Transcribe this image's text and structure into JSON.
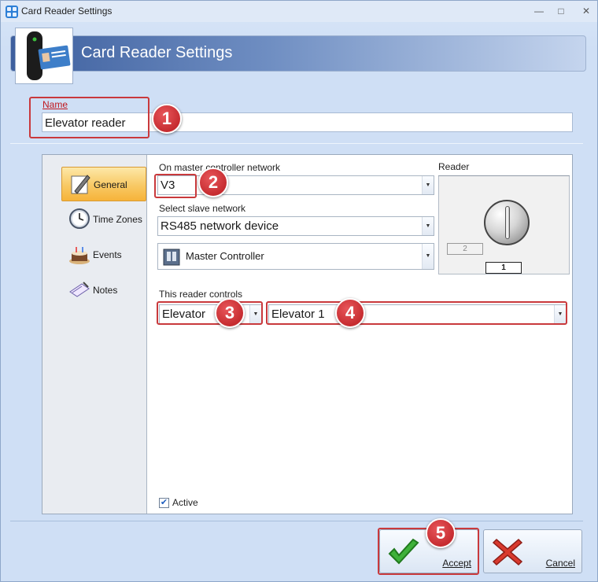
{
  "window": {
    "title": "Card Reader Settings",
    "min_glyph": "—",
    "max_glyph": "□",
    "close_glyph": "✕"
  },
  "header": {
    "title": "Card Reader Settings"
  },
  "name": {
    "label": "Name",
    "value": "Elevator reader"
  },
  "nav": {
    "items": [
      {
        "label": "General",
        "icon": "pencil-paper-icon",
        "active": true
      },
      {
        "label": "Time Zones",
        "icon": "clock-icon",
        "active": false
      },
      {
        "label": "Events",
        "icon": "cake-icon",
        "active": false
      },
      {
        "label": "Notes",
        "icon": "notes-icon",
        "active": false
      }
    ]
  },
  "general": {
    "master_network_label": "On master controller network",
    "master_network_value": "V3",
    "slave_network_label": "Select slave network",
    "slave_network_value": "RS485 network device",
    "controller_value": "Master Controller",
    "reader_label": "Reader",
    "reader_position_inactive": "2",
    "reader_position_active": "1",
    "controls_label": "This reader controls",
    "controls_type": "Elevator",
    "controls_target": "Elevator 1",
    "active_label": "Active",
    "active_checked": true
  },
  "callouts": [
    "1",
    "2",
    "3",
    "4",
    "5"
  ],
  "footer": {
    "accept_label": "Accept",
    "cancel_label": "Cancel"
  },
  "colors": {
    "highlight": "#c9393c",
    "accent": "#f6b33a",
    "banner": "#3d5f9e"
  }
}
